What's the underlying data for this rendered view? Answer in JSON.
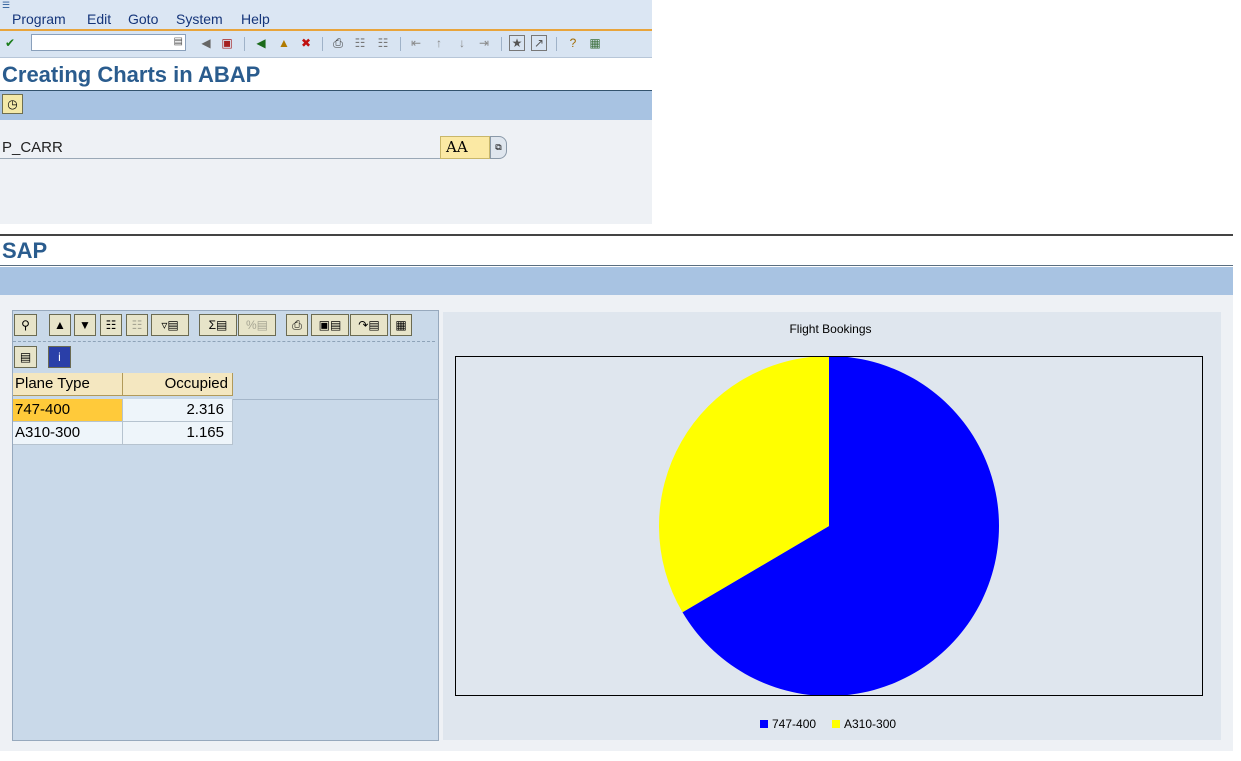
{
  "menubar": {
    "items": [
      "Program",
      "Edit",
      "Goto",
      "System",
      "Help"
    ]
  },
  "toolbar": {
    "command_field_value": ""
  },
  "screen1": {
    "title": "Creating Charts in ABAP",
    "param_label": "P_CARR",
    "param_value": "AA"
  },
  "screen2": {
    "title": "SAP",
    "table": {
      "columns": [
        "Plane Type",
        "Occupied"
      ],
      "rows": [
        [
          "747-400",
          "2.316"
        ],
        [
          "A310-300",
          "1.165"
        ]
      ]
    }
  },
  "colors": {
    "slice_1": "#0000ff",
    "slice_2": "#ffff00",
    "selected_cell": "#ffca3a"
  },
  "chart_data": {
    "type": "pie",
    "title": "Flight Bookings",
    "categories": [
      "747-400",
      "A310-300"
    ],
    "values": [
      2316,
      1165
    ],
    "colors": [
      "#0000ff",
      "#ffff00"
    ],
    "legend": "bottom-center"
  }
}
